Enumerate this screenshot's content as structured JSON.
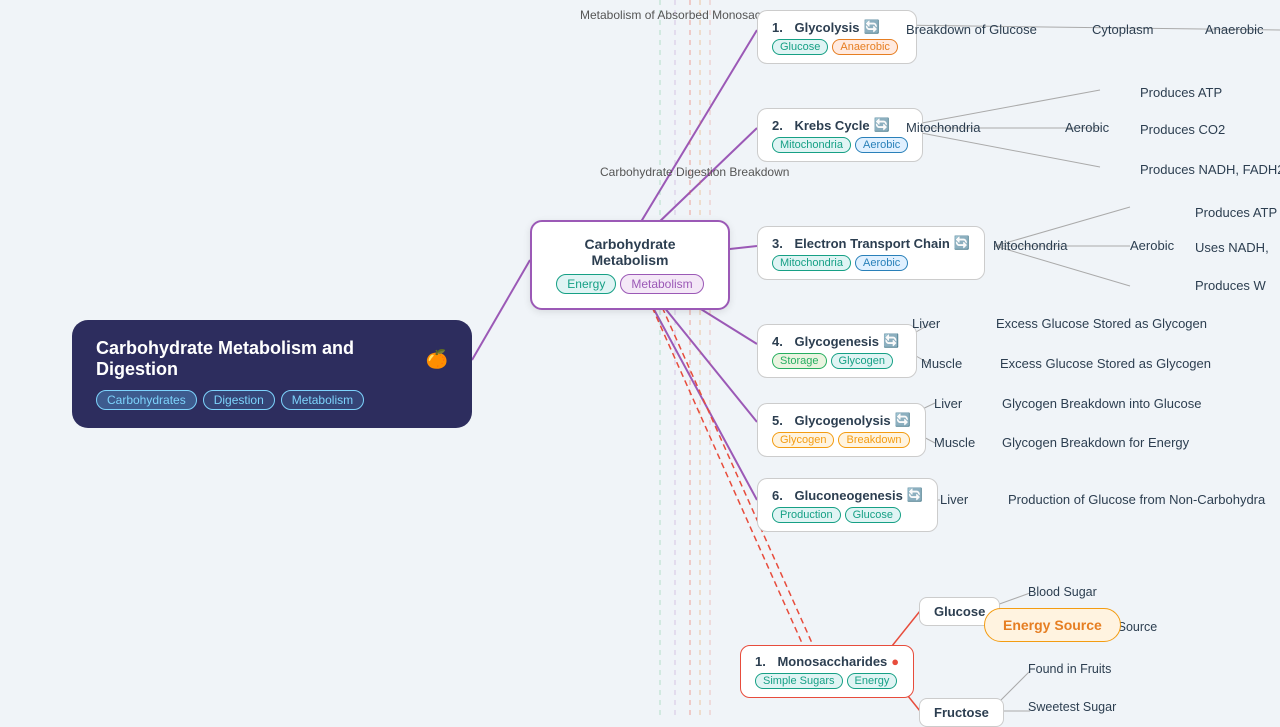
{
  "app": {
    "title": "Carbohydrate Metabolism and Digestion",
    "title_emoji": "🍊"
  },
  "main_card": {
    "title": "Carbohydrate Metabolism and Digestion",
    "emoji": "🍊",
    "tags": [
      "Carbohydrates",
      "Digestion",
      "Metabolism"
    ]
  },
  "top_label": "Metabolism of Absorbed Monosaccharides",
  "carb_digestion_label": "Carbohydrate Digestion Breakdown",
  "center_node": {
    "title": "Carbohydrate Metabolism",
    "tags": [
      "Energy",
      "Metabolism"
    ]
  },
  "processes": [
    {
      "id": "glycolysis",
      "number": "1.",
      "name": "Glycolysis",
      "emoji": "🔄",
      "tags": [
        "Glucose",
        "Anaerobic"
      ],
      "details": [
        {
          "label": "Breakdown of Glucose"
        },
        {
          "label": "Cytoplasm"
        },
        {
          "label": "Anaerobic"
        }
      ]
    },
    {
      "id": "krebs",
      "number": "2.",
      "name": "Krebs Cycle",
      "emoji": "🔄",
      "tags": [
        "Mitochondria",
        "Aerobic"
      ],
      "details": [
        {
          "label": "Mitochondria"
        },
        {
          "label": "Aerobic"
        },
        {
          "label": "Produces ATP"
        },
        {
          "label": "Produces CO2"
        },
        {
          "label": "Produces NADH, FADH2"
        }
      ]
    },
    {
      "id": "etc",
      "number": "3.",
      "name": "Electron Transport Chain",
      "emoji": "🔄",
      "tags": [
        "Mitochondria",
        "Aerobic"
      ],
      "details": [
        {
          "label": "Mitochondria"
        },
        {
          "label": "Aerobic"
        },
        {
          "label": "Produces ATP"
        },
        {
          "label": "Uses NADH,"
        },
        {
          "label": "Produces W"
        }
      ]
    },
    {
      "id": "glycogenesis",
      "number": "4.",
      "name": "Glycogenesis",
      "emoji": "🔄",
      "tags": [
        "Storage",
        "Glycogen"
      ],
      "details": [
        {
          "location": "Liver",
          "detail": "Excess Glucose Stored as Glycogen"
        },
        {
          "location": "Muscle",
          "detail": "Excess Glucose Stored as Glycogen"
        }
      ]
    },
    {
      "id": "glycogenolysis",
      "number": "5.",
      "name": "Glycogenolysis",
      "emoji": "🔄",
      "tags": [
        "Glycogen",
        "Breakdown"
      ],
      "details": [
        {
          "location": "Liver",
          "detail": "Glycogen Breakdown into Glucose"
        },
        {
          "location": "Muscle",
          "detail": "Glycogen Breakdown for Energy"
        }
      ]
    },
    {
      "id": "gluconeogenesis",
      "number": "6.",
      "name": "Gluconeogenesis",
      "emoji": "🔄",
      "tags": [
        "Production",
        "Glucose"
      ],
      "details": [
        {
          "location": "Liver",
          "detail": "Production of Glucose from Non-Carbohydra"
        }
      ]
    }
  ],
  "monosaccharides": {
    "number": "1.",
    "name": "Monosaccharides",
    "emoji": "🔴",
    "tags": [
      "Simple Sugars",
      "Energy"
    ],
    "branches": [
      {
        "name": "Glucose",
        "details": [
          "Blood Sugar",
          "Primary Energy Source"
        ]
      },
      {
        "name": "Fructose",
        "details": [
          "Found in Fruits",
          "Sweetest Sugar"
        ]
      }
    ]
  },
  "energy_source_label": "Energy Source"
}
